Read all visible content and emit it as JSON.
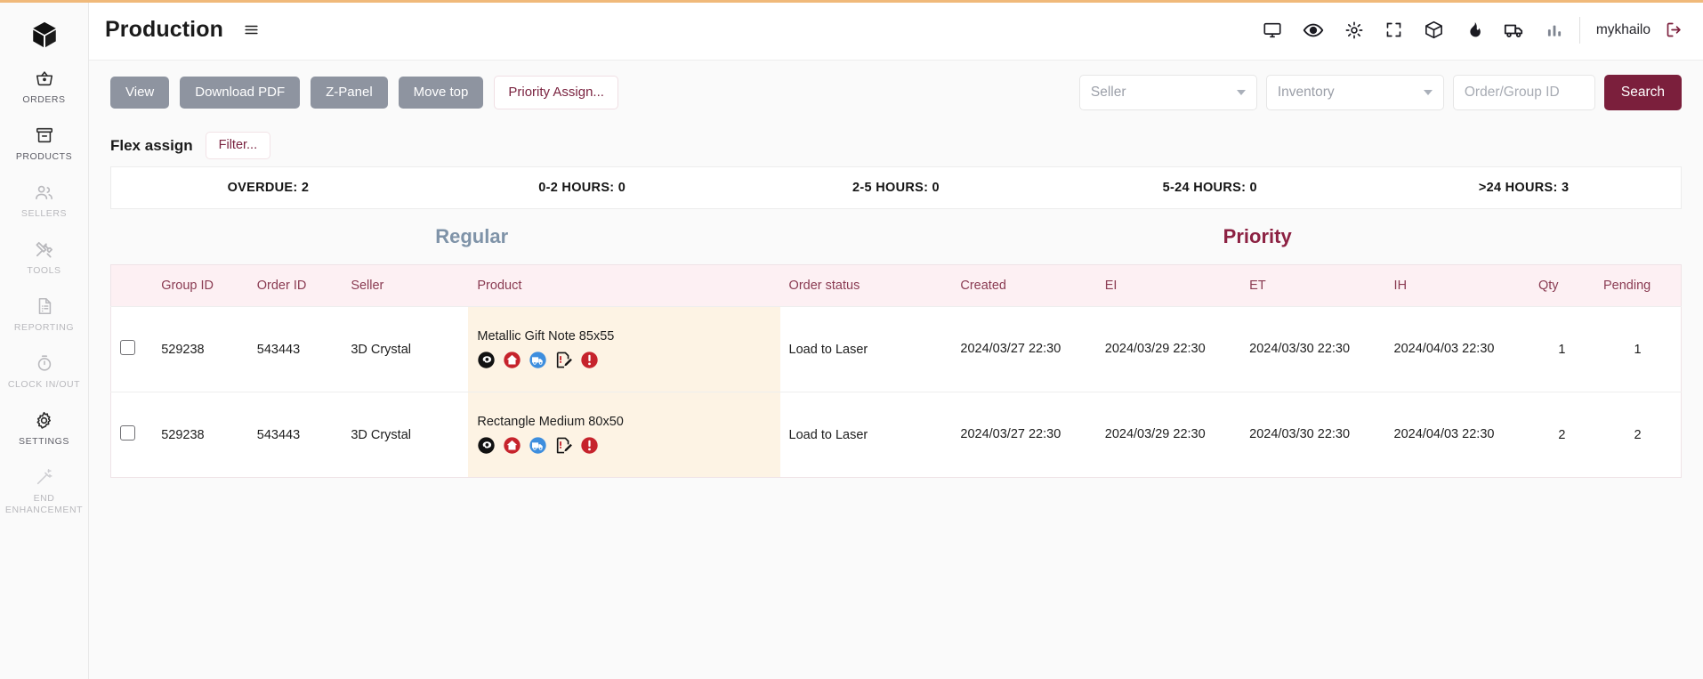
{
  "accent": {
    "top_bar": "#f0b97a",
    "priority": "#8c2142",
    "regular": "#7f93a8",
    "search_btn": "#7b1f3c",
    "product_cell": "#fdf3e4"
  },
  "sidebar": {
    "logo_icon": "cube-logo-icon",
    "items": [
      {
        "label": "ORDERS",
        "icon": "basket-icon",
        "active": true
      },
      {
        "label": "PRODUCTS",
        "icon": "archive-box-icon",
        "active": true
      },
      {
        "label": "SELLERS",
        "icon": "users-icon",
        "active": false
      },
      {
        "label": "TOOLS",
        "icon": "tools-icon",
        "active": false
      },
      {
        "label": "REPORTING",
        "icon": "document-report-icon",
        "active": false
      },
      {
        "label": "CLOCK IN/OUT",
        "icon": "stopwatch-icon",
        "active": false
      },
      {
        "label": "SETTINGS",
        "icon": "gear-icon",
        "active": true
      },
      {
        "label": "END ENHANCEMENT",
        "icon": "magic-wand-icon",
        "active": false
      }
    ]
  },
  "header": {
    "title": "Production",
    "menu_icon": "hamburger-icon",
    "icons": [
      "monitor-icon",
      "eye-icon",
      "brightness-icon",
      "fullscreen-icon",
      "package-icon",
      "flame-icon",
      "truck-icon",
      "bar-chart-icon"
    ],
    "user": "mykhailo",
    "logout_icon": "logout-icon"
  },
  "toolbar": {
    "view_label": "View",
    "download_pdf_label": "Download PDF",
    "zpanel_label": "Z-Panel",
    "move_top_label": "Move top",
    "priority_assign_label": "Priority Assign...",
    "seller_select": "Seller",
    "inventory_select": "Inventory",
    "order_group_placeholder": "Order/Group ID",
    "order_group_value": "",
    "search_label": "Search"
  },
  "flex_assign": {
    "title": "Flex assign",
    "filter_label": "Filter..."
  },
  "hours": [
    "OVERDUE: 2",
    "0-2 HOURS: 0",
    "2-5 HOURS: 0",
    "5-24 HOURS: 0",
    ">24 HOURS: 3"
  ],
  "sections": {
    "regular": "Regular",
    "priority": "Priority"
  },
  "table": {
    "columns": [
      "",
      "Group ID",
      "Order ID",
      "Seller",
      "Product",
      "Order status",
      "Created",
      "EI",
      "ET",
      "IH",
      "Qty",
      "Pending"
    ],
    "rows": [
      {
        "group_id": "529238",
        "order_id": "543443",
        "seller": "3D Crystal",
        "product": "Metallic Gift Note 85x55",
        "product_icons": [
          "preview-eye-icon",
          "home-icon",
          "shipping-truck-icon",
          "edit-note-icon",
          "alert-icon"
        ],
        "order_status": "Load to Laser",
        "created_date": "2024/03/27",
        "created_time": "22:30",
        "ei_date": "2024/03/29",
        "ei_time": "22:30",
        "et_date": "2024/03/30",
        "et_time": "22:30",
        "ih_date": "2024/04/03",
        "ih_time": "22:30",
        "qty": "1",
        "pending": "1"
      },
      {
        "group_id": "529238",
        "order_id": "543443",
        "seller": "3D Crystal",
        "product": "Rectangle Medium 80x50",
        "product_icons": [
          "preview-eye-icon",
          "home-icon",
          "shipping-truck-icon",
          "edit-note-icon",
          "alert-icon"
        ],
        "order_status": "Load to Laser",
        "created_date": "2024/03/27",
        "created_time": "22:30",
        "ei_date": "2024/03/29",
        "ei_time": "22:30",
        "et_date": "2024/03/30",
        "et_time": "22:30",
        "ih_date": "2024/04/03",
        "ih_time": "22:30",
        "qty": "2",
        "pending": "2"
      }
    ]
  }
}
